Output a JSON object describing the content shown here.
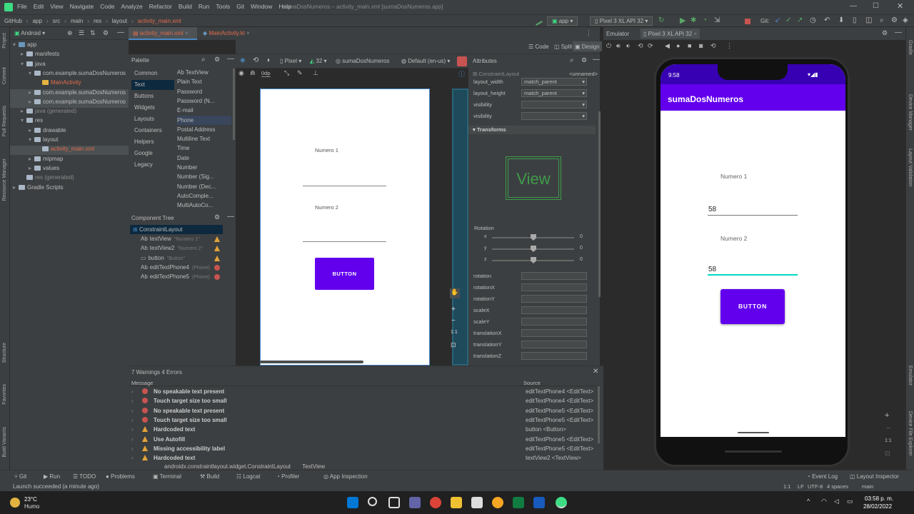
{
  "menu": {
    "items": [
      "File",
      "Edit",
      "View",
      "Navigate",
      "Code",
      "Analyze",
      "Refactor",
      "Build",
      "Run",
      "Tools",
      "Git",
      "Window",
      "Help"
    ],
    "title": "sumaDosNumeros – activity_main.xml [sumaDosNumeros.app]"
  },
  "nav": {
    "crumbs": [
      "GitHub",
      "app",
      "src",
      "main",
      "res",
      "layout",
      "activity_main.xml"
    ],
    "run_config": "app",
    "device": "Pixel 3 XL API 32",
    "git_label": "Git:"
  },
  "project": {
    "view_mode": "Android",
    "tree": [
      {
        "label": "app",
        "indent": 0,
        "icon": "fold b",
        "arrow": "▾"
      },
      {
        "label": "manifests",
        "indent": 1,
        "icon": "fold",
        "arrow": "▸"
      },
      {
        "label": "java",
        "indent": 1,
        "icon": "fold",
        "arrow": "▾"
      },
      {
        "label": "com.example.sumaDosNumeros",
        "indent": 2,
        "icon": "fold",
        "arrow": "▾"
      },
      {
        "label": "MainActivity",
        "indent": 3,
        "icon": "fold y",
        "arrow": "",
        "color": "#e06c4d"
      },
      {
        "label": "com.example.sumaDosNumeros",
        "indent": 2,
        "icon": "fold",
        "arrow": "▸",
        "sel": true
      },
      {
        "label": "com.example.sumaDosNumeros",
        "indent": 2,
        "icon": "fold",
        "arrow": "▸",
        "sel": true
      },
      {
        "label": "java (generated)",
        "indent": 1,
        "icon": "fold",
        "arrow": "▸",
        "color": "#888888"
      },
      {
        "label": "res",
        "indent": 1,
        "icon": "fold",
        "arrow": "▾"
      },
      {
        "label": "drawable",
        "indent": 2,
        "icon": "fold",
        "arrow": "▸"
      },
      {
        "label": "layout",
        "indent": 2,
        "icon": "fold",
        "arrow": "▾"
      },
      {
        "label": "activity_main.xml",
        "indent": 3,
        "icon": "fold",
        "arrow": "",
        "color": "#e06c4d",
        "sel": true
      },
      {
        "label": "mipmap",
        "indent": 2,
        "icon": "fold",
        "arrow": "▸"
      },
      {
        "label": "values",
        "indent": 2,
        "icon": "fold",
        "arrow": "▸"
      },
      {
        "label": "res (generated)",
        "indent": 1,
        "icon": "fold",
        "arrow": "",
        "color": "#888888"
      },
      {
        "label": "Gradle Scripts",
        "indent": 0,
        "icon": "fold",
        "arrow": "▸"
      }
    ]
  },
  "left_side_labels": [
    "Project",
    "Commit",
    "Pull Requests",
    "Resource Manager",
    "Structure",
    "Favorites",
    "Build Variants"
  ],
  "right_side_labels": [
    "Gradle",
    "Device Manager",
    "Layout Validation",
    "Emulator",
    "Device File Explorer"
  ],
  "editor_tabs": [
    {
      "label": "activity_main.xml",
      "active": true
    },
    {
      "label": "MainActivity.kt",
      "active": false
    }
  ],
  "view_modes": [
    "Code",
    "Split",
    "Design"
  ],
  "palette": {
    "title": "Palette",
    "categories": [
      "Common",
      "Text",
      "Buttons",
      "Widgets",
      "Layouts",
      "Containers",
      "Helpers",
      "Google",
      "Legacy"
    ],
    "selected_category": 1,
    "items": [
      "Ab TextView",
      "Plain Text",
      "Password",
      "Password (N...",
      "E-mail",
      "Phone",
      "Postal Address",
      "Multiline Text",
      "Time",
      "Date",
      "Number",
      "Number (Sig...",
      "Number (Dec...",
      "AutoComple...",
      "MultiAutoCo..."
    ],
    "selected_item": 5
  },
  "design_toolbar": {
    "device": "Pixel",
    "api": "32",
    "app": "sumaDosNumeros",
    "locale": "Default (en-us)",
    "margin": "0dp"
  },
  "component_tree": {
    "title": "Component Tree",
    "root": "ConstraintLayout",
    "rows": [
      {
        "prefix": "Ab",
        "name": "textView",
        "hint": "\"Numero 1\"",
        "status": "warn"
      },
      {
        "prefix": "Ab",
        "name": "textView2",
        "hint": "\"Numero 2\"",
        "status": "warn"
      },
      {
        "prefix": "",
        "name": "button",
        "hint": "\"Button\"",
        "status": "warn"
      },
      {
        "prefix": "Ab",
        "name": "editTextPhone4",
        "hint": "(Phone)",
        "status": "err"
      },
      {
        "prefix": "Ab",
        "name": "editTextPhone5",
        "hint": "(Phone)",
        "status": "err"
      }
    ]
  },
  "canvas": {
    "label1": "Numero 1",
    "label2": "Numero 2",
    "button": "BUTTON"
  },
  "attributes": {
    "title": "Attributes",
    "component": "ConstraintLayout",
    "id_value": "<unnamed>",
    "fields": [
      {
        "label": "layout_width",
        "value": "match_parent"
      },
      {
        "label": "layout_height",
        "value": "match_parent"
      },
      {
        "label": "visibility",
        "value": ""
      },
      {
        "label": "visibility",
        "value": ""
      }
    ],
    "transforms_title": "Transforms",
    "preview_text": "View",
    "rotation_title": "Rotation",
    "sliders": [
      {
        "axis": "x",
        "value": "0"
      },
      {
        "axis": "y",
        "value": "0"
      },
      {
        "axis": "z",
        "value": "0"
      }
    ],
    "props": [
      "rotation",
      "rotationX",
      "rotationY",
      "scaleX",
      "scaleY",
      "translationX",
      "translationY",
      "translationZ"
    ]
  },
  "problems": {
    "title": "7 Warnings 4 Errors",
    "col_message": "Message",
    "col_source": "Source",
    "rows": [
      {
        "type": "err",
        "message": "No speakable text present",
        "source": "editTextPhone4 <EditText>"
      },
      {
        "type": "err",
        "message": "Touch target size too small",
        "source": "editTextPhone4 <EditText>"
      },
      {
        "type": "err",
        "message": "No speakable text present",
        "source": "editTextPhone5 <EditText>"
      },
      {
        "type": "err",
        "message": "Touch target size too small",
        "source": "editTextPhone5 <EditText>"
      },
      {
        "type": "warn",
        "message": "Hardcoded text",
        "source": "button <Button>"
      },
      {
        "type": "warn",
        "message": "Use Autofill",
        "source": "editTextPhone5 <EditText>"
      },
      {
        "type": "warn",
        "message": "Missing accessibility label",
        "source": "editTextPhone5 <EditText>"
      },
      {
        "type": "warn",
        "message": "Hardcoded text",
        "source": "textView2 <TextView>"
      }
    ],
    "path": [
      "androidx.constraintlayout.widget.ConstraintLayout",
      "TextView"
    ]
  },
  "emulator": {
    "title": "Emulator",
    "device_tab": "Pixel 3 XL API 32",
    "phone": {
      "time": "9:58",
      "app_title": "sumaDosNumeros",
      "label1": "Numero 1",
      "value1": "58",
      "label2": "Numero 2",
      "value2": "58",
      "button": "BUTTON"
    },
    "zoom_ratio": "1:1"
  },
  "bottom_tabs": [
    "Git",
    "Run",
    "TODO",
    "Problems",
    "Terminal",
    "Build",
    "Logcat",
    "Profiler",
    "App Inspection"
  ],
  "bottom_right_tabs": [
    "Event Log",
    "Layout Inspector"
  ],
  "status": {
    "message": "Launch succeeded (a minute ago)",
    "right": [
      "1:1",
      "LF",
      "UTF-8",
      "4 spaces",
      "main"
    ]
  },
  "taskbar": {
    "temp": "23°C",
    "weather": "Humo",
    "time": "03:58 p. m.",
    "date": "28/02/2022"
  },
  "colors": {
    "purple": "#6200ee",
    "purple_dark": "#3700b3",
    "accent": "#4a88c7",
    "teal": "#03dac5"
  }
}
